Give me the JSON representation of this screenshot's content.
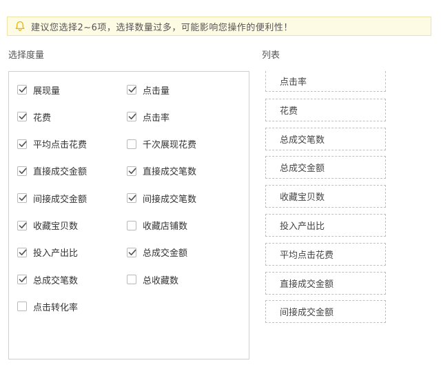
{
  "notice": {
    "icon": "bell-icon",
    "text": "建议您选择2~6项，选择数量过多，可能影响您操作的便利性！"
  },
  "select_title": "选择度量",
  "list_title": "列表",
  "options": [
    {
      "label": "展现量",
      "checked": true
    },
    {
      "label": "点击量",
      "checked": true
    },
    {
      "label": "花费",
      "checked": true
    },
    {
      "label": "点击率",
      "checked": true
    },
    {
      "label": "平均点击花费",
      "checked": true
    },
    {
      "label": "千次展现花费",
      "checked": false
    },
    {
      "label": "直接成交金额",
      "checked": true
    },
    {
      "label": "直接成交笔数",
      "checked": true
    },
    {
      "label": "间接成交金额",
      "checked": true
    },
    {
      "label": "间接成交笔数",
      "checked": true
    },
    {
      "label": "收藏宝贝数",
      "checked": true
    },
    {
      "label": "收藏店铺数",
      "checked": false
    },
    {
      "label": "投入产出比",
      "checked": true
    },
    {
      "label": "总成交金额",
      "checked": true
    },
    {
      "label": "总成交笔数",
      "checked": true
    },
    {
      "label": "总收藏数",
      "checked": false
    },
    {
      "label": "点击转化率",
      "checked": false
    }
  ],
  "list_items": [
    "点击率",
    "花费",
    "总成交笔数",
    "总成交金额",
    "收藏宝贝数",
    "投入产出比",
    "平均点击花费",
    "直接成交金额",
    "间接成交金额"
  ],
  "colors": {
    "notice_bg": "#fefbe5",
    "notice_border": "#f0e2a6",
    "bell": "#e8b400",
    "checkmark": "#555555"
  }
}
